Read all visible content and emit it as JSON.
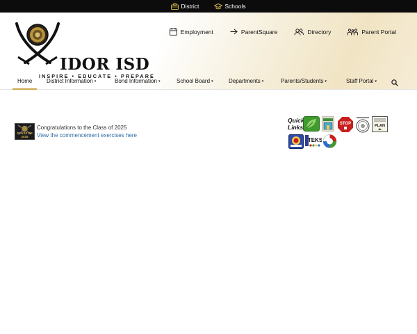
{
  "topbar": {
    "district_label": "District",
    "schools_label": "Schools",
    "district_icon": "briefcase-icon",
    "schools_icon": "graduation-cap-icon"
  },
  "logo": {
    "name": "IDOR ISD",
    "tagline": "INSPIRE • EDUCATE • PREPARE"
  },
  "header_links": [
    {
      "label": "Employment",
      "icon": "calendar-icon"
    },
    {
      "label": "ParentSquare",
      "icon": "arrow-right-icon"
    },
    {
      "label": "Directory",
      "icon": "people-icon"
    },
    {
      "label": "Parent Portal",
      "icon": "family-icon"
    }
  ],
  "nav": {
    "items": [
      {
        "label": "Home",
        "active": true
      },
      {
        "label": "District Information",
        "dropdown": true
      },
      {
        "label": "Bond Information",
        "dropdown": true
      },
      {
        "label": "School Board",
        "dropdown": true
      },
      {
        "label": "Departments",
        "dropdown": true
      },
      {
        "label": "Parents/Students",
        "dropdown": true
      },
      {
        "label": "Staff Portal",
        "dropdown": true
      }
    ],
    "caret": "▾",
    "search_icon": "search-icon"
  },
  "post": {
    "thumb_text": "CLASS OF 2025",
    "title": "Congratulations to the Class of 2025",
    "link": "View the commencement exercises here"
  },
  "quick_links": {
    "label_line1": "Quick",
    "label_line2": "Links",
    "stop_text": "STOP",
    "plan_text": "PLAN",
    "teks_text": "TEKS"
  },
  "colors": {
    "accent": "#c9a94a",
    "link": "#2b6aa3",
    "topbar": "#0c0c0c"
  }
}
